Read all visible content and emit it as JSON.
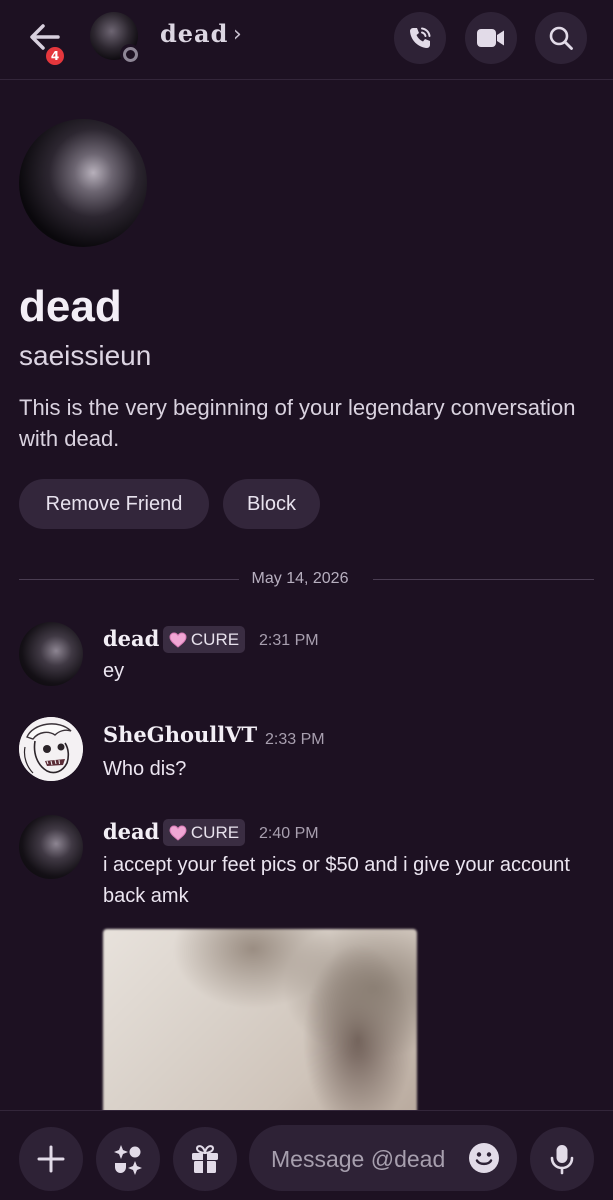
{
  "header": {
    "notification_count": "4",
    "channel_name": "dead",
    "chevron": "›",
    "icons": [
      "back-arrow-icon",
      "phone-call-icon",
      "video-camera-icon",
      "search-icon"
    ]
  },
  "profile": {
    "display_name": "dead",
    "username": "saeissieun",
    "intro_text": "This is the very beginning of your legendary conversation with dead.",
    "buttons": {
      "remove_friend": "Remove Friend",
      "block": "Block"
    }
  },
  "date_divider": "May 14, 2026",
  "messages": [
    {
      "author": "dead",
      "tag": "CURE",
      "time": "2:31 PM",
      "text": "ey"
    },
    {
      "author": "SheGhoullVT",
      "time": "2:33 PM",
      "text": "Who dis?"
    },
    {
      "author": "dead",
      "tag": "CURE",
      "time": "2:40 PM",
      "text": "i accept your feet pics or $50 and i give your account back amk"
    }
  ],
  "composer": {
    "placeholder": "Message @dead",
    "icons": [
      "plus-icon",
      "apps-icon",
      "gift-icon",
      "emoji-icon",
      "microphone-icon"
    ]
  },
  "colors": {
    "background": "#1d1122",
    "surface": "#2e2236",
    "tag_heart": "#f0a6d4",
    "badge": "#e5373d"
  }
}
